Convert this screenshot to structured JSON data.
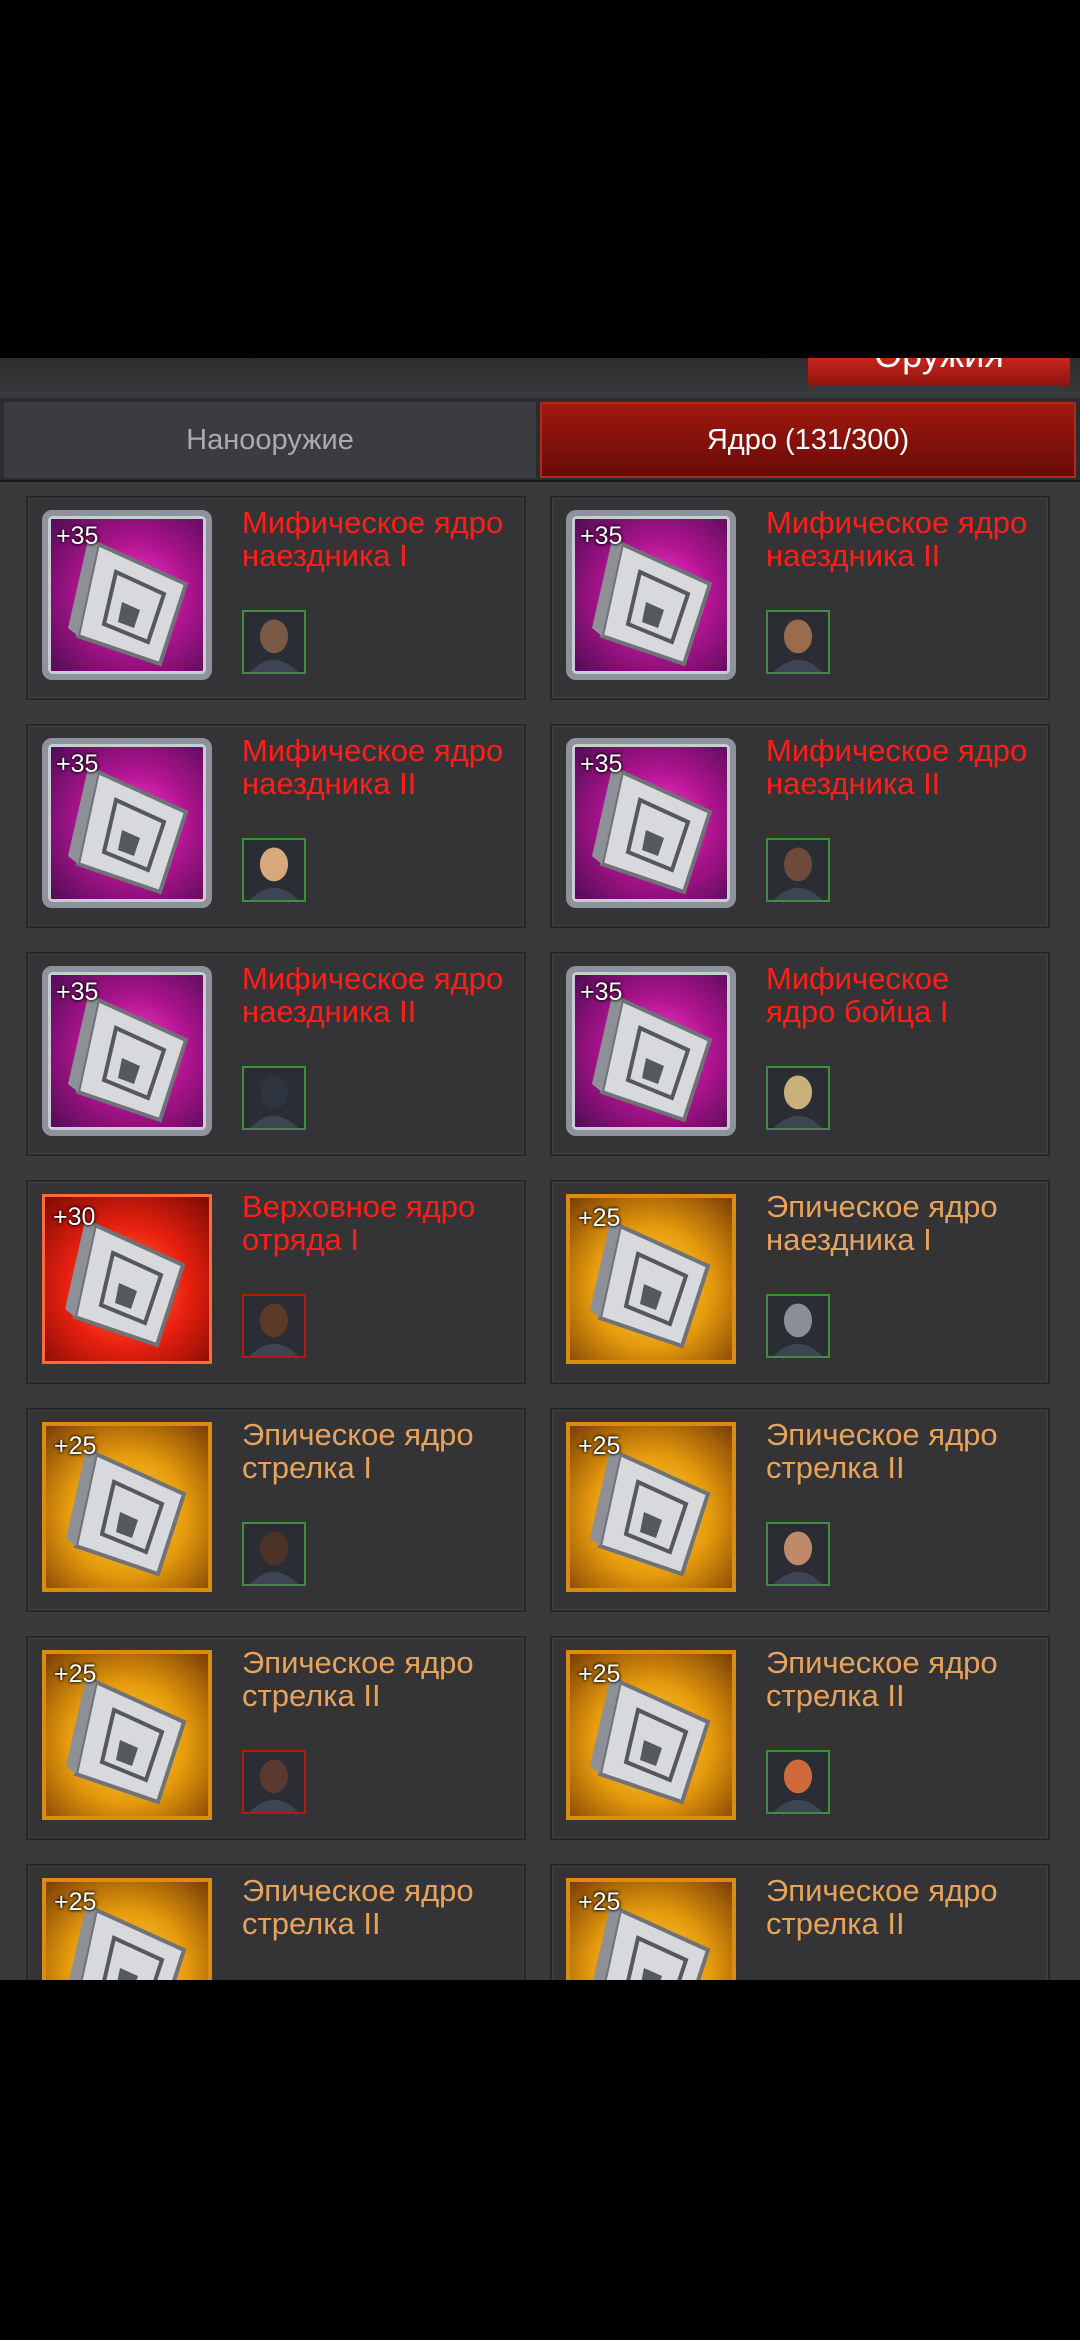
{
  "header": {
    "weapons_tab_label": "Оружия"
  },
  "tabs": [
    {
      "label": "Нанооружие",
      "active": false
    },
    {
      "label": "Ядро (131/300)",
      "active": true
    }
  ],
  "colors": {
    "mythic_name": "#ff1e17",
    "epic_name": "#e8a35a",
    "active_tab": "#8e1410"
  },
  "cards": [
    {
      "level": "+35",
      "name_line1": "Мифическое ядро",
      "name_line2": "наездника I",
      "tier": "mythic",
      "symbol": "rider",
      "hero": "hero-sunglasses-portrait"
    },
    {
      "level": "+35",
      "name_line1": "Мифическое ядро",
      "name_line2": "наездника II",
      "tier": "mythic",
      "symbol": "rider",
      "hero": "hero-man-portrait"
    },
    {
      "level": "+35",
      "name_line1": "Мифическое ядро",
      "name_line2": "наездника II",
      "tier": "mythic",
      "symbol": "rider",
      "hero": "hero-nurse-portrait"
    },
    {
      "level": "+35",
      "name_line1": "Мифическое ядро",
      "name_line2": "наездника II",
      "tier": "mythic",
      "symbol": "rider",
      "hero": "hero-bearded-man-portrait"
    },
    {
      "level": "+35",
      "name_line1": "Мифическое ядро",
      "name_line2": "наездника II",
      "tier": "mythic",
      "symbol": "rider",
      "hero": "hero-masked-hood-portrait"
    },
    {
      "level": "+35",
      "name_line1": "Мифическое",
      "name_line2": "ядро бойца I",
      "tier": "mythic",
      "symbol": "fighter",
      "hero": "hero-gasmask-portrait"
    },
    {
      "level": "+30",
      "name_line1": "Верховное ядро",
      "name_line2": "отряда I",
      "tier": "supreme",
      "symbol": "squad",
      "hero": "hero-cowboy-portrait"
    },
    {
      "level": "+25",
      "name_line1": "Эпическое ядро",
      "name_line2": "наездника I",
      "tier": "epic",
      "symbol": "rider",
      "hero": "hero-masked-man-portrait"
    },
    {
      "level": "+25",
      "name_line1": "Эпическое ядро",
      "name_line2": "стрелка I",
      "tier": "epic",
      "symbol": "shooter",
      "hero": "hero-soldier-portrait"
    },
    {
      "level": "+25",
      "name_line1": "Эпическое ядро",
      "name_line2": "стрелка II",
      "tier": "epic",
      "symbol": "shooter",
      "hero": "hero-woman-bangs-portrait"
    },
    {
      "level": "+25",
      "name_line1": "Эпическое ядро",
      "name_line2": "стрелка II",
      "tier": "epic",
      "symbol": "shooter",
      "hero": "hero-woman-dark-portrait"
    },
    {
      "level": "+25",
      "name_line1": "Эпическое ядро",
      "name_line2": "стрелка II",
      "tier": "epic",
      "symbol": "shooter",
      "hero": "hero-redhead-portrait"
    },
    {
      "level": "+25",
      "name_line1": "Эпическое ядро",
      "name_line2": "стрелка II",
      "tier": "epic",
      "symbol": "shooter",
      "hero": ""
    },
    {
      "level": "+25",
      "name_line1": "Эпическое ядро",
      "name_line2": "стрелка II",
      "tier": "epic",
      "symbol": "shooter",
      "hero": ""
    }
  ]
}
